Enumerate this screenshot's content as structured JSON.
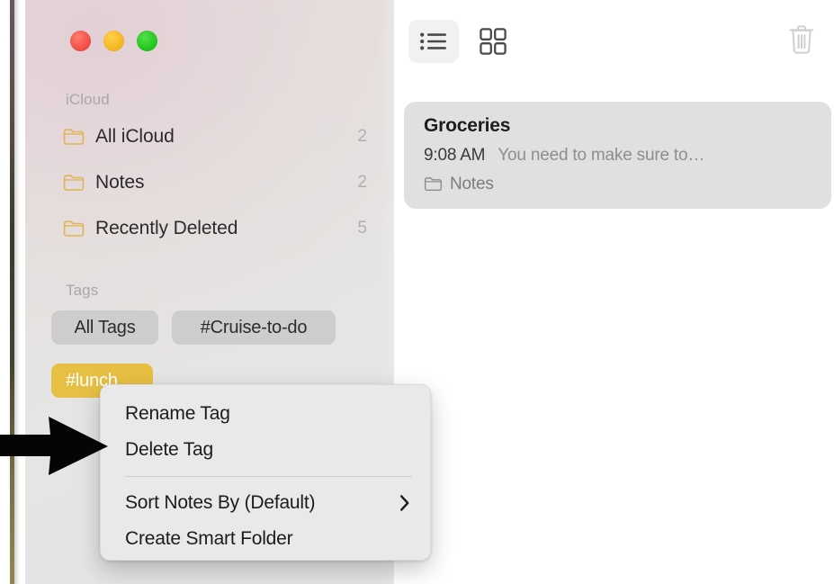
{
  "app": {
    "name": "Notes",
    "window_controls": [
      {
        "name": "close",
        "color": "#f04a42"
      },
      {
        "name": "minimize",
        "color": "#f5b321"
      },
      {
        "name": "zoom",
        "color": "#1fc318"
      }
    ]
  },
  "sidebar": {
    "sections": [
      {
        "header": "iCloud",
        "items": [
          {
            "icon": "folder-icon",
            "label": "All iCloud",
            "count": "2"
          },
          {
            "icon": "folder-icon",
            "label": "Notes",
            "count": "2"
          },
          {
            "icon": "folder-icon",
            "label": "Recently Deleted",
            "count": "5"
          }
        ]
      },
      {
        "header": "Tags",
        "tags": [
          {
            "label": "All Tags",
            "style": "grey",
            "selected": false
          },
          {
            "label": "#Cruise-to-do",
            "style": "grey",
            "selected": false
          },
          {
            "label": "#lunch",
            "style": "gold",
            "selected": true
          }
        ]
      }
    ]
  },
  "toolbar": {
    "list_view_label": "list-view",
    "gallery_view_label": "gallery-view",
    "trash_label": "delete-note",
    "active_view": "list-view"
  },
  "notes_list": {
    "items": [
      {
        "title": "Groceries",
        "time": "9:08 AM",
        "snippet": "You need to make sure to…",
        "folder": "Notes",
        "selected": true
      }
    ]
  },
  "context_menu": {
    "items": [
      {
        "label": "Rename Tag",
        "submenu": false,
        "separator_after": false
      },
      {
        "label": "Delete Tag",
        "submenu": false,
        "separator_after": true
      },
      {
        "label": "Sort Notes By (Default)",
        "submenu": true,
        "separator_after": false
      },
      {
        "label": "Create Smart Folder",
        "submenu": false,
        "separator_after": false
      }
    ]
  },
  "annotation": {
    "arrow_label": "pointer-arrow",
    "points_to": "Delete Tag"
  },
  "colors": {
    "tag_selected": "#e7bf43",
    "tag_default": "#cdcdcd",
    "folder_icon": "#e2b356",
    "note_card": "#e0e0e0",
    "menu_bg": "#e9e9e9"
  }
}
